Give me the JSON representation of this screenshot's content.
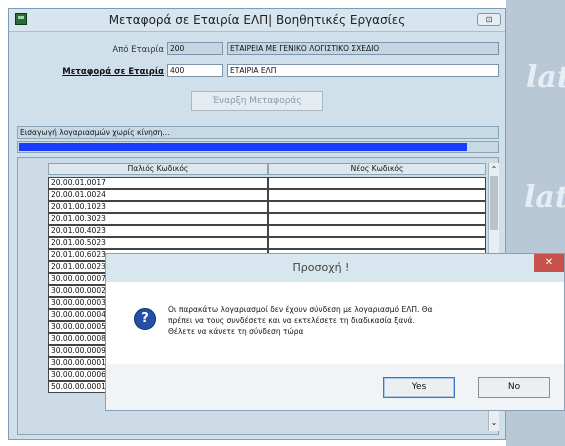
{
  "window": {
    "title": "Μεταφορά σε Εταιρία ΕΛΠ| Βοηθητικές Εργασίες",
    "close_label": "⊡"
  },
  "source_company": {
    "label": "Από Εταιρία",
    "code": "200",
    "name": "ΕΤΑΙΡΕΙΑ ΜΕ ΓΕΝΙΚΟ ΛΟΓΙΣΤΙΚΟ ΣΧΕΔΙΟ"
  },
  "target_company": {
    "label": "Μεταφορά σε Εταιρία",
    "code": "400",
    "name": "ΕΤΑΙΡΙΑ ΕΛΠ"
  },
  "start_button_label": "Έναρξη Μεταφοράς",
  "status_text": "Εισαγωγή λογαριασμών χωρίς κίνηση...",
  "progress": {
    "value": 0.937,
    "color": "#1a3cff"
  },
  "grid": {
    "headers": [
      "Παλιός Κωδικός",
      "Νέος Κωδικός"
    ],
    "rows": [
      "20.00.01.0017",
      "20.00.01.0024",
      "20.01.00.1023",
      "20.01.00.3023",
      "20.01.00.4023",
      "20.01.00.5023",
      "20.01.00.6023",
      "20.01.00.0023",
      "30.00.00.0007",
      "30.00.00.0002",
      "30.00.00.0003",
      "30.00.00.0004",
      "30.00.00.0005",
      "30.00.00.0008",
      "30.00.00.0009",
      "30.00.00.0001",
      "30.00.00.0006",
      "50.00.00.0001"
    ]
  },
  "dialog": {
    "title": "Προσοχή !",
    "close_label": "✕",
    "icon": "question-icon",
    "message_lines": [
      "Οι παρακάτω λογαριασμοί δεν έχουν σύνδεση με λογαριασμό ΕΛΠ. Θα",
      "πρέπει να τους συνδέσετε και να εκτελέσετε τη διαδικασία ξανά.",
      "Θέλετε να κάνετε τη σύνδεση τώρα"
    ],
    "yes_label": "Yes",
    "no_label": "No"
  },
  "watermark_text": "lat"
}
